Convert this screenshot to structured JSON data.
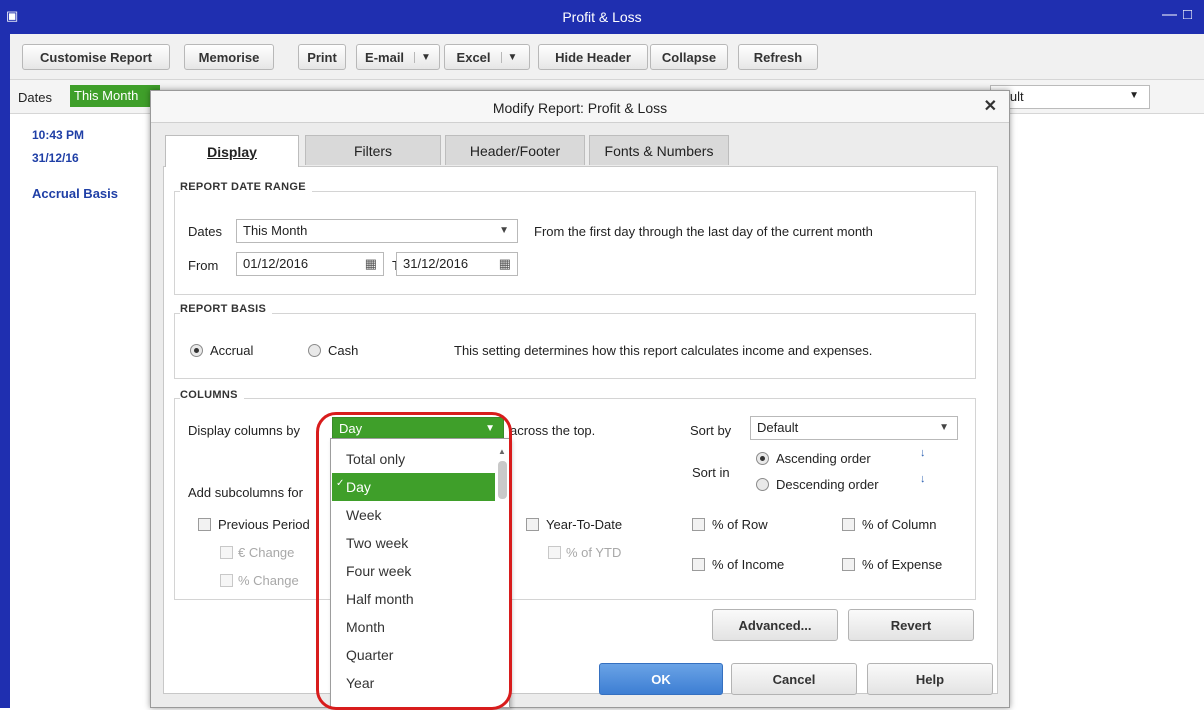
{
  "window": {
    "title": "Profit & Loss"
  },
  "toolbar": {
    "customise": "Customise Report",
    "memorise": "Memorise",
    "print": "Print",
    "email": "E-mail",
    "excel": "Excel",
    "hide_header": "Hide Header",
    "collapse": "Collapse",
    "refresh": "Refresh"
  },
  "filterbar": {
    "dates_label": "Dates",
    "dates_value": "This Month",
    "basis_value": "fault"
  },
  "report_header": {
    "time": "10:43 PM",
    "date": "31/12/16",
    "basis": "Accrual Basis"
  },
  "dialog": {
    "title": "Modify Report: Profit & Loss",
    "tabs": [
      "Display",
      "Filters",
      "Header/Footer",
      "Fonts & Numbers"
    ],
    "date_range": {
      "section": "REPORT DATE RANGE",
      "dates_label": "Dates",
      "dates_value": "This Month",
      "description": "From the first day through the last day of the current month",
      "from_label": "From",
      "from_value": "01/12/2016",
      "to_label": "To",
      "to_value": "31/12/2016"
    },
    "basis": {
      "section": "REPORT BASIS",
      "accrual": "Accrual",
      "cash": "Cash",
      "selected": "Accrual",
      "description": "This setting determines how this report calculates income and expenses."
    },
    "columns": {
      "section": "COLUMNS",
      "display_label": "Display columns by",
      "display_value": "Day",
      "across": "across the top.",
      "sort_by_label": "Sort by",
      "sort_by_value": "Default",
      "sort_in_label": "Sort in",
      "ascending": "Ascending order",
      "descending": "Descending order",
      "subcolumns_label": "Add subcolumns for",
      "previous_period": "Previous Period",
      "euro_change": "€ Change",
      "pct_change": "% Change",
      "ytd": "Year-To-Date",
      "pct_ytd": "% of YTD",
      "pct_row": "% of Row",
      "pct_column": "% of Column",
      "pct_income": "% of Income",
      "pct_expense": "% of Expense"
    },
    "advanced": "Advanced...",
    "revert": "Revert",
    "ok": "OK",
    "cancel": "Cancel",
    "help": "Help"
  },
  "dropdown": {
    "items": [
      "Total only",
      "Day",
      "Week",
      "Two week",
      "Four week",
      "Half month",
      "Month",
      "Quarter",
      "Year"
    ],
    "selected": "Day"
  },
  "colors": {
    "title_bar": "#1f2fb0",
    "selection_green": "#3f9f2a",
    "ok_blue": "#3d7ed3",
    "highlight_red": "#d81c1c"
  }
}
